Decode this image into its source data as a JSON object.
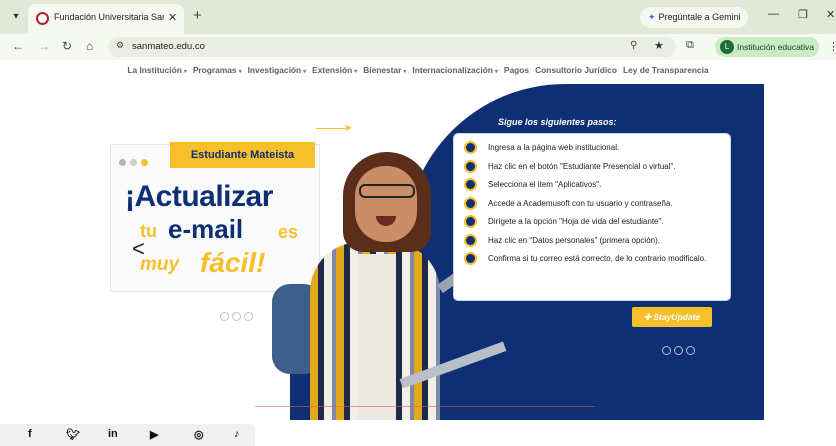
{
  "browser": {
    "tab_title": "Fundación Universitaria San Ma",
    "tab_close": "✕",
    "new_tab": "+",
    "gemini_label": "Pregúntale a Gemini",
    "minimize": "—",
    "restore": "❐",
    "close": "✕",
    "url": "sanmateo.edu.co",
    "profile_label": "Institución educativa",
    "profile_initial": "L"
  },
  "sitenav": {
    "items": [
      {
        "label": "La Institución",
        "caret": true
      },
      {
        "label": "Programas",
        "caret": true
      },
      {
        "label": "Investigación",
        "caret": true
      },
      {
        "label": "Extensión",
        "caret": true
      },
      {
        "label": "Bienestar",
        "caret": true
      },
      {
        "label": "Internacionalización",
        "caret": true
      },
      {
        "label": "Pagos",
        "caret": false
      },
      {
        "label": "Consultorio Jurídico",
        "caret": false
      },
      {
        "label": "Ley de Transparencia",
        "caret": false
      }
    ]
  },
  "hero": {
    "badge": "Estudiante Mateista",
    "headline_1": "¡Actualizar",
    "headline_tu": "tu",
    "headline_email": "e-mail",
    "headline_es": "es",
    "headline_muy": "muy",
    "headline_facil": "fácil!",
    "prev": "<",
    "next": ">",
    "steps_title": "Sigue los siguientes pasos:",
    "steps": [
      "Ingresa a la página web institucional.",
      "Haz clic en el botón \"Estudiante Presencial o virtual\".",
      "Selecciona el item \"Aplicativos\".",
      "Accede a Academusoft con tu usuario y contraseña.",
      "Dirígete a la opción \"Hoja de vida del estudiante\".",
      "Haz clic en \"Datos personales\" (primera opción).",
      "Confirma si tu correo está correcto, de lo contrario modificalo."
    ],
    "stayupdate": "✚ StayUpdate"
  },
  "colors": {
    "brand_blue": "#0e2f73",
    "brand_yellow": "#f5c02a",
    "accent_orange": "#f16a1c"
  },
  "social": {
    "icons": [
      "facebook-icon",
      "twitter-icon",
      "linkedin-icon",
      "youtube-icon",
      "instagram-icon",
      "tiktok-icon"
    ]
  }
}
